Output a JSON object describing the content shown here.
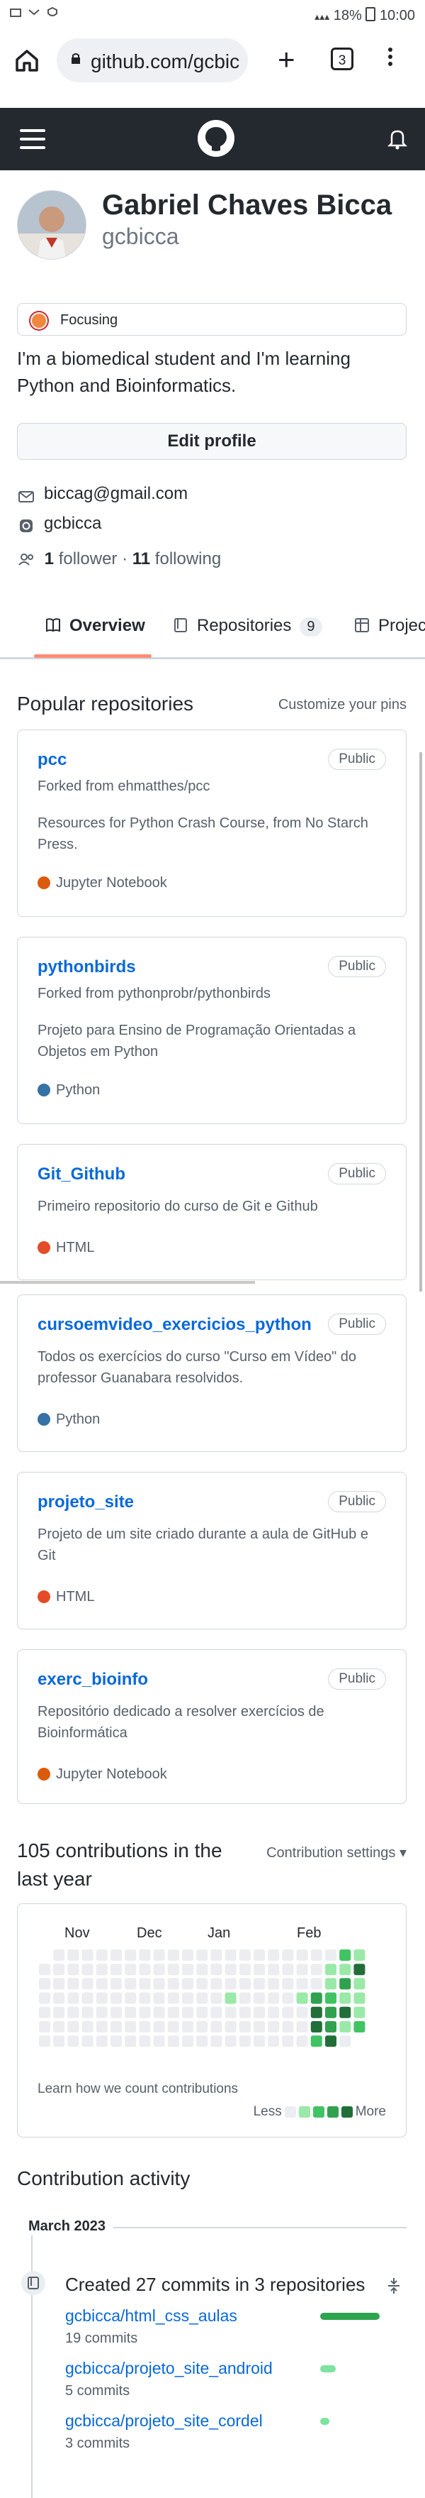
{
  "status_bar": {
    "battery": "18%",
    "time": "10:00"
  },
  "browser": {
    "url": "github.com/gcbicca",
    "tab_count": "3"
  },
  "profile": {
    "name": "Gabriel Chaves Bicca",
    "login": "gcbicca",
    "status": "Focusing",
    "bio": "I'm a biomedical student and I'm learning Python and Bioinformatics.",
    "edit_label": "Edit profile",
    "email": "biccag@gmail.com",
    "instagram": "gcbicca",
    "followers_count": "1",
    "followers_label": "follower",
    "following_count": "11",
    "following_label": "following"
  },
  "tabs": [
    {
      "label": "Overview"
    },
    {
      "label": "Repositories",
      "count": "9"
    },
    {
      "label": "Projects"
    }
  ],
  "popular": {
    "title": "Popular repositories",
    "customize": "Customize your pins",
    "repos": [
      {
        "name": "pcc",
        "badge": "Public",
        "fork": "Forked from ehmatthes/pcc",
        "description": "Resources for Python Crash Course, from No Starch Press.",
        "language": "Jupyter Notebook",
        "lang_color": "#DA5B0B"
      },
      {
        "name": "pythonbirds",
        "badge": "Public",
        "fork": "Forked from pythonprobr/pythonbirds",
        "description": "Projeto para Ensino de Programação Orientadas a Objetos em Python",
        "language": "Python",
        "lang_color": "#3572A5"
      },
      {
        "name": "Git_Github",
        "badge": "Public",
        "fork": "",
        "description": "Primeiro repositorio do curso de Git e Github",
        "language": "HTML",
        "lang_color": "#e34c26"
      },
      {
        "name": "cursoemvideo_exercicios_python",
        "badge": "Public",
        "fork": "",
        "description": "Todos os exercícios do curso \"Curso em Vídeo\" do professor Guanabara resolvidos.",
        "language": "Python",
        "lang_color": "#3572A5"
      },
      {
        "name": "projeto_site",
        "badge": "Public",
        "fork": "",
        "description": "Projeto de um site criado durante a aula de GitHub e Git",
        "language": "HTML",
        "lang_color": "#e34c26"
      },
      {
        "name": "exerc_bioinfo",
        "badge": "Public",
        "fork": "",
        "description": "Repositório dedicado a resolver exercícios de Bioinformática",
        "language": "Jupyter Notebook",
        "lang_color": "#DA5B0B"
      }
    ]
  },
  "contributions": {
    "title": "105 contributions in the last year",
    "settings": "Contribution settings ▾",
    "months": [
      "Nov",
      "Dec",
      "Jan",
      "Feb"
    ],
    "learn": "Learn how we count contributions",
    "less": "Less",
    "more": "More",
    "colors": [
      "#ebedf0",
      "#9be9a8",
      "#40c463",
      "#30a14e",
      "#216e39"
    ]
  },
  "activity": {
    "title": "Contribution activity",
    "month": "March 2023",
    "summary": "Created 27 commits in 3 repositories",
    "repos": [
      {
        "name": "gcbicca/html_css_aulas",
        "commits": "19 commits",
        "share": 0.7
      },
      {
        "name": "gcbicca/projeto_site_android",
        "commits": "5 commits",
        "share": 0.18
      },
      {
        "name": "gcbicca/projeto_site_cordel",
        "commits": "3 commits",
        "share": 0.11
      }
    ]
  }
}
